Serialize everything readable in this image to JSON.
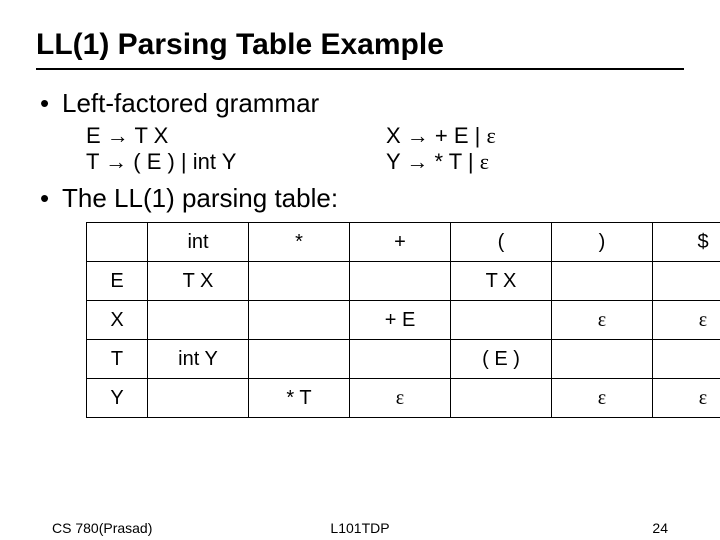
{
  "title": "LL(1) Parsing Table Example",
  "bullets": {
    "b1": "Left-factored grammar",
    "b2": "The LL(1) parsing table:"
  },
  "grammar": {
    "l1a": "E ",
    "l1arrow": "→",
    "l1b": " T X",
    "l2a": "T ",
    "l2arrow": "→",
    "l2b": " ( E ) | int Y",
    "r1a": "X ",
    "r1arrow": "→",
    "r1b": " + E | ",
    "r1eps": "ε",
    "r2a": "Y ",
    "r2arrow": "→",
    "r2b": " * T | ",
    "r2eps": "ε"
  },
  "table": {
    "headers": {
      "h_blank": "",
      "h_int": "int",
      "h_star": "*",
      "h_plus": "+",
      "h_lpar": "(",
      "h_rpar": ")",
      "h_dollar": "$"
    },
    "rows": {
      "E": {
        "label": "E",
        "int": "T X",
        "star": "",
        "plus": "",
        "lpar": "T X",
        "rpar": "",
        "dollar": ""
      },
      "X": {
        "label": "X",
        "int": "",
        "star": "",
        "plus": "+ E",
        "lpar": "",
        "rpar": "ε",
        "dollar": "ε"
      },
      "T": {
        "label": "T",
        "int": "int Y",
        "star": "",
        "plus": "",
        "lpar": "( E )",
        "rpar": "",
        "dollar": ""
      },
      "Y": {
        "label": "Y",
        "int": "",
        "star": "* T",
        "plus": "ε",
        "lpar": "",
        "rpar": "ε",
        "dollar": "ε"
      }
    }
  },
  "footer": {
    "left": "CS 780(Prasad)",
    "center": "L101TDP",
    "right": "24"
  }
}
